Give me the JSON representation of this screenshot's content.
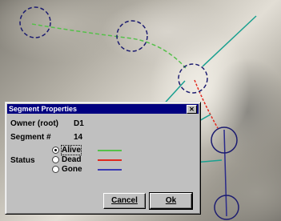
{
  "dialog": {
    "title": "Segment Properties",
    "close_glyph": "✕",
    "owner_label": "Owner (root)",
    "owner_value": "D1",
    "segment_label": "Segment #",
    "segment_value": "14",
    "status_label": "Status",
    "status_options": [
      "Alive",
      "Dead",
      "Gone"
    ],
    "status_selected": "Alive",
    "cancel_label": "Cancel",
    "ok_label": "Ok"
  },
  "colors": {
    "alive": "#55c04a",
    "dead": "#e0281e",
    "gone": "#3c3cb4",
    "callout": "#1aa090",
    "node_ring": "#1c1c70",
    "titlebar": "#000080"
  },
  "icons": [
    "close-icon",
    "radio-button-icon"
  ]
}
